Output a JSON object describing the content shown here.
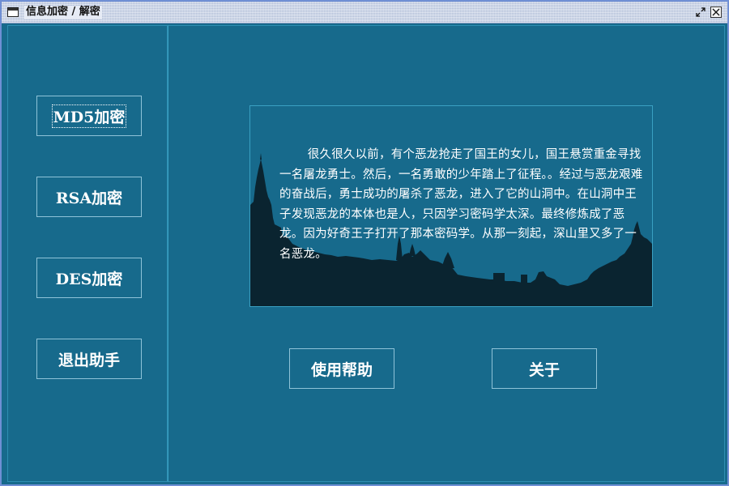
{
  "window": {
    "title": "信息加密 / 解密",
    "restore_icon": "restore-icon",
    "close_icon": "close-icon"
  },
  "sidebar": {
    "buttons": [
      {
        "label": "MD5加密"
      },
      {
        "label": "RSA加密"
      },
      {
        "label": "DES加密"
      },
      {
        "label": "退出助手"
      }
    ]
  },
  "main": {
    "story": "很久很久以前，有个恶龙抢走了国王的女儿，国王悬赏重金寻找一名屠龙勇士。然后，一名勇敢的少年踏上了征程。。经过与恶龙艰难的奋战后，勇士成功的屠杀了恶龙，进入了它的山洞中。在山洞中王子发现恶龙的本体也是人，只因学习密码学太深。最终修炼成了恶龙。因为好奇王子打开了那本密码学。从那一刻起，深山里又多了一名恶龙。",
    "help_label": "使用帮助",
    "about_label": "关于"
  },
  "colors": {
    "background": "#176a8c",
    "border": "#2e8fb2",
    "silhouette": "#0a2430",
    "text": "#ffffff"
  }
}
